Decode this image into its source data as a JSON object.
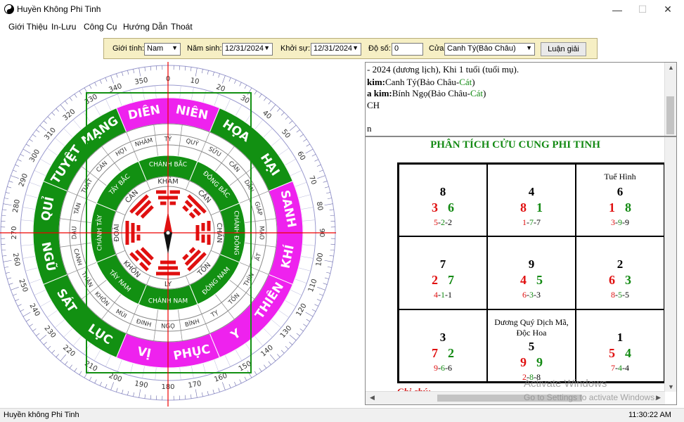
{
  "window": {
    "title": "Huyền Không Phi Tinh",
    "minimize": "—",
    "maximize": "☐",
    "close": "✕"
  },
  "menu": [
    "Giới Thiệu",
    "In-Lưu",
    "Công Cụ",
    "Hướng Dẫn",
    "Thoát"
  ],
  "toolbar": {
    "gender_label": "Giới tính:",
    "gender_value": "Nam",
    "birth_label": "Năm sinh:",
    "birth_value": "12/31/2024",
    "start_label": "Khởi sự:",
    "start_value": "12/31/2024",
    "degree_label": "Độ số:",
    "degree_value": "0",
    "door_label": "Cửa:",
    "door_value": "Canh Tý(Bảo Châu)",
    "button": "Luận giải"
  },
  "compass": {
    "ring_scale": [
      "0",
      "10",
      "20",
      "30",
      "40",
      "50",
      "60",
      "70",
      "80",
      "90",
      "100",
      "110",
      "120",
      "130",
      "140",
      "150",
      "160",
      "170",
      "180",
      "190",
      "200",
      "210",
      "220",
      "230",
      "240",
      "250",
      "260",
      "270",
      "280",
      "290",
      "300",
      "310",
      "320",
      "330",
      "340",
      "350"
    ],
    "ring_stars": [
      {
        "label": "DIÊN NIÊN",
        "color": "#ee22ee"
      },
      {
        "label": "HỌA HẠI",
        "color": "#129012"
      },
      {
        "label": "SANH KHÍ",
        "color": "#ee22ee"
      },
      {
        "label": "THIÊN Y",
        "color": "#ee22ee"
      },
      {
        "label": "PHỤC VỊ",
        "color": "#ee22ee"
      },
      {
        "label": "LỤC SÁT",
        "color": "#129012"
      },
      {
        "label": "NGŨ QUỈ",
        "color": "#129012"
      },
      {
        "label": "TUYỆT MẠNG",
        "color": "#129012"
      }
    ],
    "ring_directions": [
      "CHÁNH BẮC",
      "ĐÔNG BẮC",
      "CHÁNH ĐÔNG",
      "ĐÔNG NAM",
      "CHÁNH NAM",
      "TÂY NAM",
      "CHÁNH TÂY",
      "TÂY BẮC"
    ],
    "ring_trigrams": [
      "KHẢM",
      "CẤN",
      "CHẤN",
      "TỐN",
      "LY",
      "KHÔN",
      "ĐOÀI",
      "CÀN"
    ],
    "ring_mountains": [
      "NHÂM",
      "TÝ",
      "QUÝ",
      "SỬU",
      "CẤN",
      "DẦN",
      "GIÁP",
      "MÃO",
      "ẤT",
      "THÌN",
      "TỐN",
      "TỴ",
      "BÍNH",
      "NGỌ",
      "ĐINH",
      "MÙI",
      "KHÔN",
      "THÂN",
      "CANH",
      "DẬU",
      "TÂN",
      "TUẤT",
      "CÀN",
      "HỢI"
    ],
    "colors": {
      "green": "#129012",
      "magenta": "#ee22ee",
      "red": "#e01010",
      "crosshair": "#ee0000"
    }
  },
  "text_pane": {
    "line1": " - 2024 (dương lịch), Khi 1 tuổi (tuổi mụ).",
    "line2_label": "kim:",
    "line2_value": "Canh Tý(Bảo Châu-",
    "line2_good": "Cát",
    "line2_end": ")",
    "line3_label": "a kim:",
    "line3_value": "Bính Ngọ(Bảo Châu-",
    "line3_good": "Cát",
    "line3_end": ")",
    "line4": "CH",
    "line5": "n"
  },
  "analysis": {
    "title": "PHÂN TÍCH CỬU CUNG PHI TINH",
    "cells": [
      {
        "note": "",
        "main": "8",
        "left": "3",
        "right": "6",
        "t1": "5",
        "t2": "2",
        "t3": "2"
      },
      {
        "note": "",
        "main": "4",
        "left": "8",
        "right": "1",
        "t1": "1",
        "t2": "7",
        "t3": "7"
      },
      {
        "note": "Tuế Hình",
        "main": "6",
        "left": "1",
        "right": "8",
        "t1": "3",
        "t2": "9",
        "t3": "9"
      },
      {
        "note": "",
        "main": "7",
        "left": "2",
        "right": "7",
        "t1": "4",
        "t2": "1",
        "t3": "1"
      },
      {
        "note": "",
        "main": "9",
        "left": "4",
        "right": "5",
        "t1": "6",
        "t2": "3",
        "t3": "3"
      },
      {
        "note": "",
        "main": "2",
        "left": "6",
        "right": "3",
        "t1": "8",
        "t2": "5",
        "t3": "5"
      },
      {
        "note": "",
        "main": "3",
        "left": "7",
        "right": "2",
        "t1": "9",
        "t2": "6",
        "t3": "6"
      },
      {
        "note": "Dương Quý Dịch Mã, Độc Hoa",
        "main": "5",
        "left": "9",
        "right": "9",
        "t1": "2",
        "t2": "8",
        "t3": "8"
      },
      {
        "note": "",
        "main": "1",
        "left": "5",
        "right": "4",
        "t1": "7",
        "t2": "4",
        "t3": "4"
      }
    ],
    "footnote": "Ghi chú:"
  },
  "watermark": {
    "line1": "Activate Windows",
    "line2": "Go to Settings to activate Windows."
  },
  "status": {
    "app": "Huyền không Phi Tinh",
    "time": "11:30:22 AM"
  }
}
